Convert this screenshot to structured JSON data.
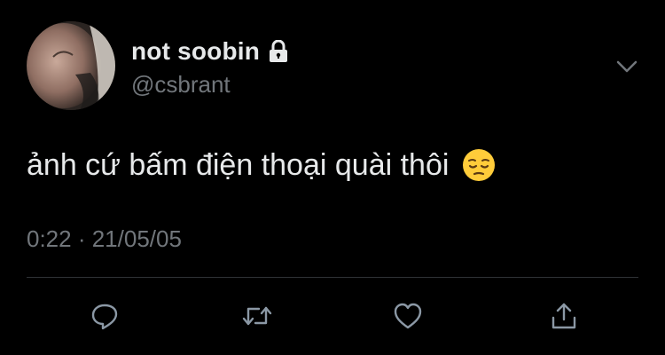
{
  "profile": {
    "display_name": "not soobin",
    "handle": "@csbrant",
    "avatar_icon": "profile-photo",
    "protected_icon": "lock-icon"
  },
  "tweet": {
    "text": "ảnh cứ bấm điện thoại quài thôi",
    "emoji_icon": "pensive-face-emoji",
    "timestamp": "0:22 · 21/05/05"
  },
  "menu": {
    "icon": "chevron-down-icon"
  },
  "actions": [
    {
      "icon": "reply-icon"
    },
    {
      "icon": "retweet-icon"
    },
    {
      "icon": "like-heart-icon"
    },
    {
      "icon": "share-icon"
    }
  ],
  "colors": {
    "background": "#000000",
    "primary_text": "#e7e9ea",
    "secondary_text": "#71767b",
    "icon": "#8b98a5",
    "divider": "#2f3336"
  }
}
